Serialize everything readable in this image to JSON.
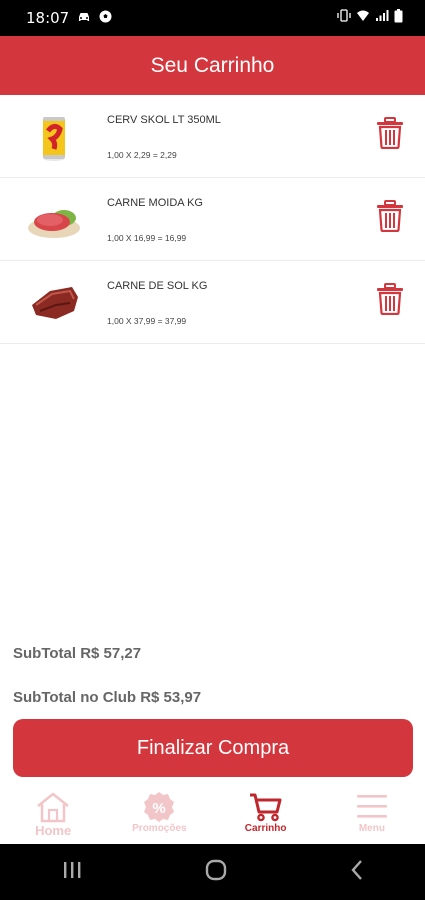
{
  "status_bar": {
    "time": "18:07",
    "icons": [
      "car-icon",
      "soccer-ball-icon",
      "vibrate-icon",
      "wifi-icon",
      "signal-icon",
      "battery-icon"
    ]
  },
  "header": {
    "title": "Seu Carrinho"
  },
  "cart": {
    "items": [
      {
        "name": "CERV SKOL LT 350ML",
        "calc": "1,00 X 2,29 = 2,29",
        "thumb": "beer-can-image"
      },
      {
        "name": "CARNE MOIDA KG",
        "calc": "1,00 X 16,99 = 16,99",
        "thumb": "ground-beef-image"
      },
      {
        "name": "CARNE DE SOL KG",
        "calc": "1,00 X 37,99 = 37,99",
        "thumb": "dried-beef-image"
      }
    ]
  },
  "summary": {
    "subtotal": "SubTotal R$ 57,27",
    "club_subtotal": "SubTotal no Club R$ 53,97"
  },
  "checkout_label": "Finalizar Compra",
  "nav": {
    "home": "Home",
    "promocoes": "Promoções",
    "carrinho": "Carrinho",
    "menu": "Menu",
    "promo_icon_glyph": "%"
  },
  "colors": {
    "brand": "#d3363c",
    "active_nav": "#c0272d",
    "inactive_nav": "#f2c6c8"
  }
}
